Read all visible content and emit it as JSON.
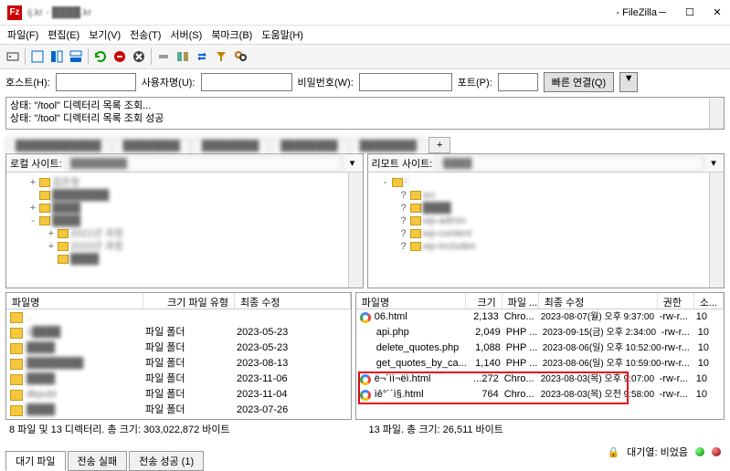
{
  "window": {
    "title_blurred": "ij.kr - ████.kr",
    "title_app": " - FileZilla"
  },
  "menu": [
    "파일(F)",
    "편집(E)",
    "보기(V)",
    "전송(T)",
    "서버(S)",
    "북마크(B)",
    "도움말(H)"
  ],
  "quickconnect": {
    "host_label": "호스트(H):",
    "user_label": "사용자명(U):",
    "pass_label": "비밀번호(W):",
    "port_label": "포트(P):",
    "button": "빠른 연결(Q)"
  },
  "log": {
    "line1": "상태: \"/tool\" 디렉터리 목록 조회...",
    "line2": "상태: \"/tool\" 디렉터리 목록 조회 성공"
  },
  "local": {
    "label": "로컬 사이트:",
    "path": "████████",
    "tree": [
      {
        "ind": 20,
        "exp": "+",
        "label": "검은창"
      },
      {
        "ind": 20,
        "exp": "",
        "label": "████████"
      },
      {
        "ind": 20,
        "exp": "+",
        "label": "████"
      },
      {
        "ind": 20,
        "exp": "-",
        "label": "████"
      },
      {
        "ind": 40,
        "exp": "+",
        "label": "2021년 과정"
      },
      {
        "ind": 40,
        "exp": "+",
        "label": "2022년 과정"
      },
      {
        "ind": 40,
        "exp": "",
        "label": "████"
      }
    ],
    "headers": [
      "파일명",
      "크기 파일 유형",
      "최종 수정"
    ],
    "rows": [
      {
        "name": "..",
        "type": "",
        "date": ""
      },
      {
        "name": "1████",
        "type": "파일 폴더",
        "date": "2023-05-23"
      },
      {
        "name": "████",
        "type": "파일 폴더",
        "date": "2023-05-23"
      },
      {
        "name": "████████",
        "type": "파일 폴더",
        "date": "2023-08-13"
      },
      {
        "name": "████",
        "type": "파일 폴더",
        "date": "2023-11-06"
      },
      {
        "name": "dkpubl",
        "type": "파일 폴더",
        "date": "2023-11-04"
      },
      {
        "name": "████",
        "type": "파일 폴더",
        "date": "2023-07-26"
      }
    ],
    "status": "8 파일 및 13 디렉터리. 총 크기: 303,022,872 바이트"
  },
  "remote": {
    "label": "리모트 사이트:",
    "path": "/████",
    "tree": [
      {
        "ind": 10,
        "exp": "-",
        "label": "/"
      },
      {
        "ind": 30,
        "exp": "?",
        "label": "src"
      },
      {
        "ind": 30,
        "exp": "?",
        "label": "████"
      },
      {
        "ind": 30,
        "exp": "?",
        "label": "wp-admin"
      },
      {
        "ind": 30,
        "exp": "?",
        "label": "wp-content"
      },
      {
        "ind": 30,
        "exp": "?",
        "label": "wp-includes"
      }
    ],
    "headers": [
      "파일명",
      "크기",
      "파일 ...",
      "최종 수정",
      "권한",
      "소..."
    ],
    "rows": [
      {
        "icon": "chrome",
        "name": "06.html",
        "size": "2,133",
        "type": "Chro...",
        "date": "2023-08-07(월) 오후 9:37:00",
        "perm": "-rw-r...",
        "own": "10"
      },
      {
        "icon": "php",
        "name": "api.php",
        "size": "2,049",
        "type": "PHP ...",
        "date": "2023-09-15(금) 오후 2:34:00",
        "perm": "-rw-r...",
        "own": "10"
      },
      {
        "icon": "php",
        "name": "delete_quotes.php",
        "size": "1,088",
        "type": "PHP ...",
        "date": "2023-08-06(일) 오후 10:52:00",
        "perm": "-rw-r...",
        "own": "10"
      },
      {
        "icon": "php",
        "name": "get_quotes_by_ca...",
        "size": "1,140",
        "type": "PHP ...",
        "date": "2023-08-06(일) 오후 10:59:00",
        "perm": "-rw-r...",
        "own": "10"
      },
      {
        "icon": "chrome",
        "name": "ë¬´ìì¬ëì.html",
        "size": "...272",
        "type": "Chro...",
        "date": "2023-08-03(목) 오후 9:07:00",
        "perm": "-rw-r...",
        "own": "10"
      },
      {
        "icon": "chrome",
        "name": "ìê°´´ì§.html",
        "size": "764",
        "type": "Chro...",
        "date": "2023-08-03(목) 오전 9:58:00",
        "perm": "-rw-r...",
        "own": "10"
      }
    ],
    "status": "13 파일. 총 크기: 26,511 바이트"
  },
  "bottom_tabs": [
    "대기 파일",
    "전송 실패",
    "전송 성공 (1)"
  ],
  "queue_status": "대기열: 비었음"
}
